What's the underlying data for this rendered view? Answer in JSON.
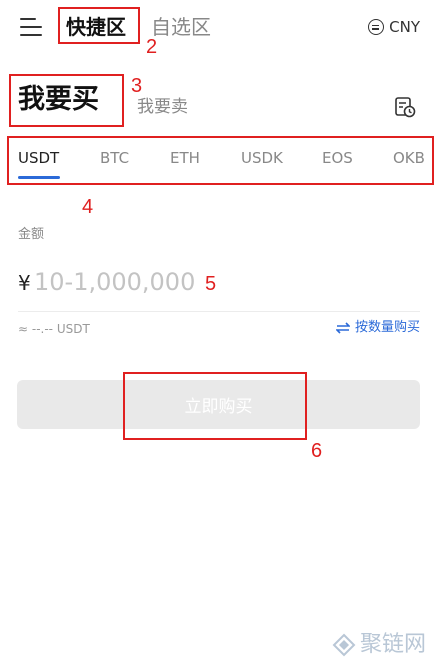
{
  "header": {
    "tab_quick": "快捷区",
    "tab_self": "自选区",
    "currency": "CNY",
    "menu_icon": "menu-icon",
    "currency_icon": "swap-circle-icon"
  },
  "trade": {
    "buy": "我要买",
    "sell": "我要卖",
    "history_icon": "order-history-icon"
  },
  "coins": {
    "items": [
      "USDT",
      "BTC",
      "ETH",
      "USDK",
      "EOS",
      "OKB"
    ],
    "active_index": 0
  },
  "amount": {
    "label": "金额",
    "symbol": "¥",
    "value": "",
    "placeholder": "10-1,000,000",
    "approx": "≈ --.-- USDT",
    "by_quantity": "按数量购买"
  },
  "action": {
    "buy_now": "立即购买"
  },
  "annotations": [
    "2",
    "3",
    "4",
    "5",
    "6"
  ],
  "watermark": "聚链网",
  "colors": {
    "accent": "#2b6ad8",
    "annotation": "#e02020",
    "button_disabled": "#e9e9e9"
  }
}
